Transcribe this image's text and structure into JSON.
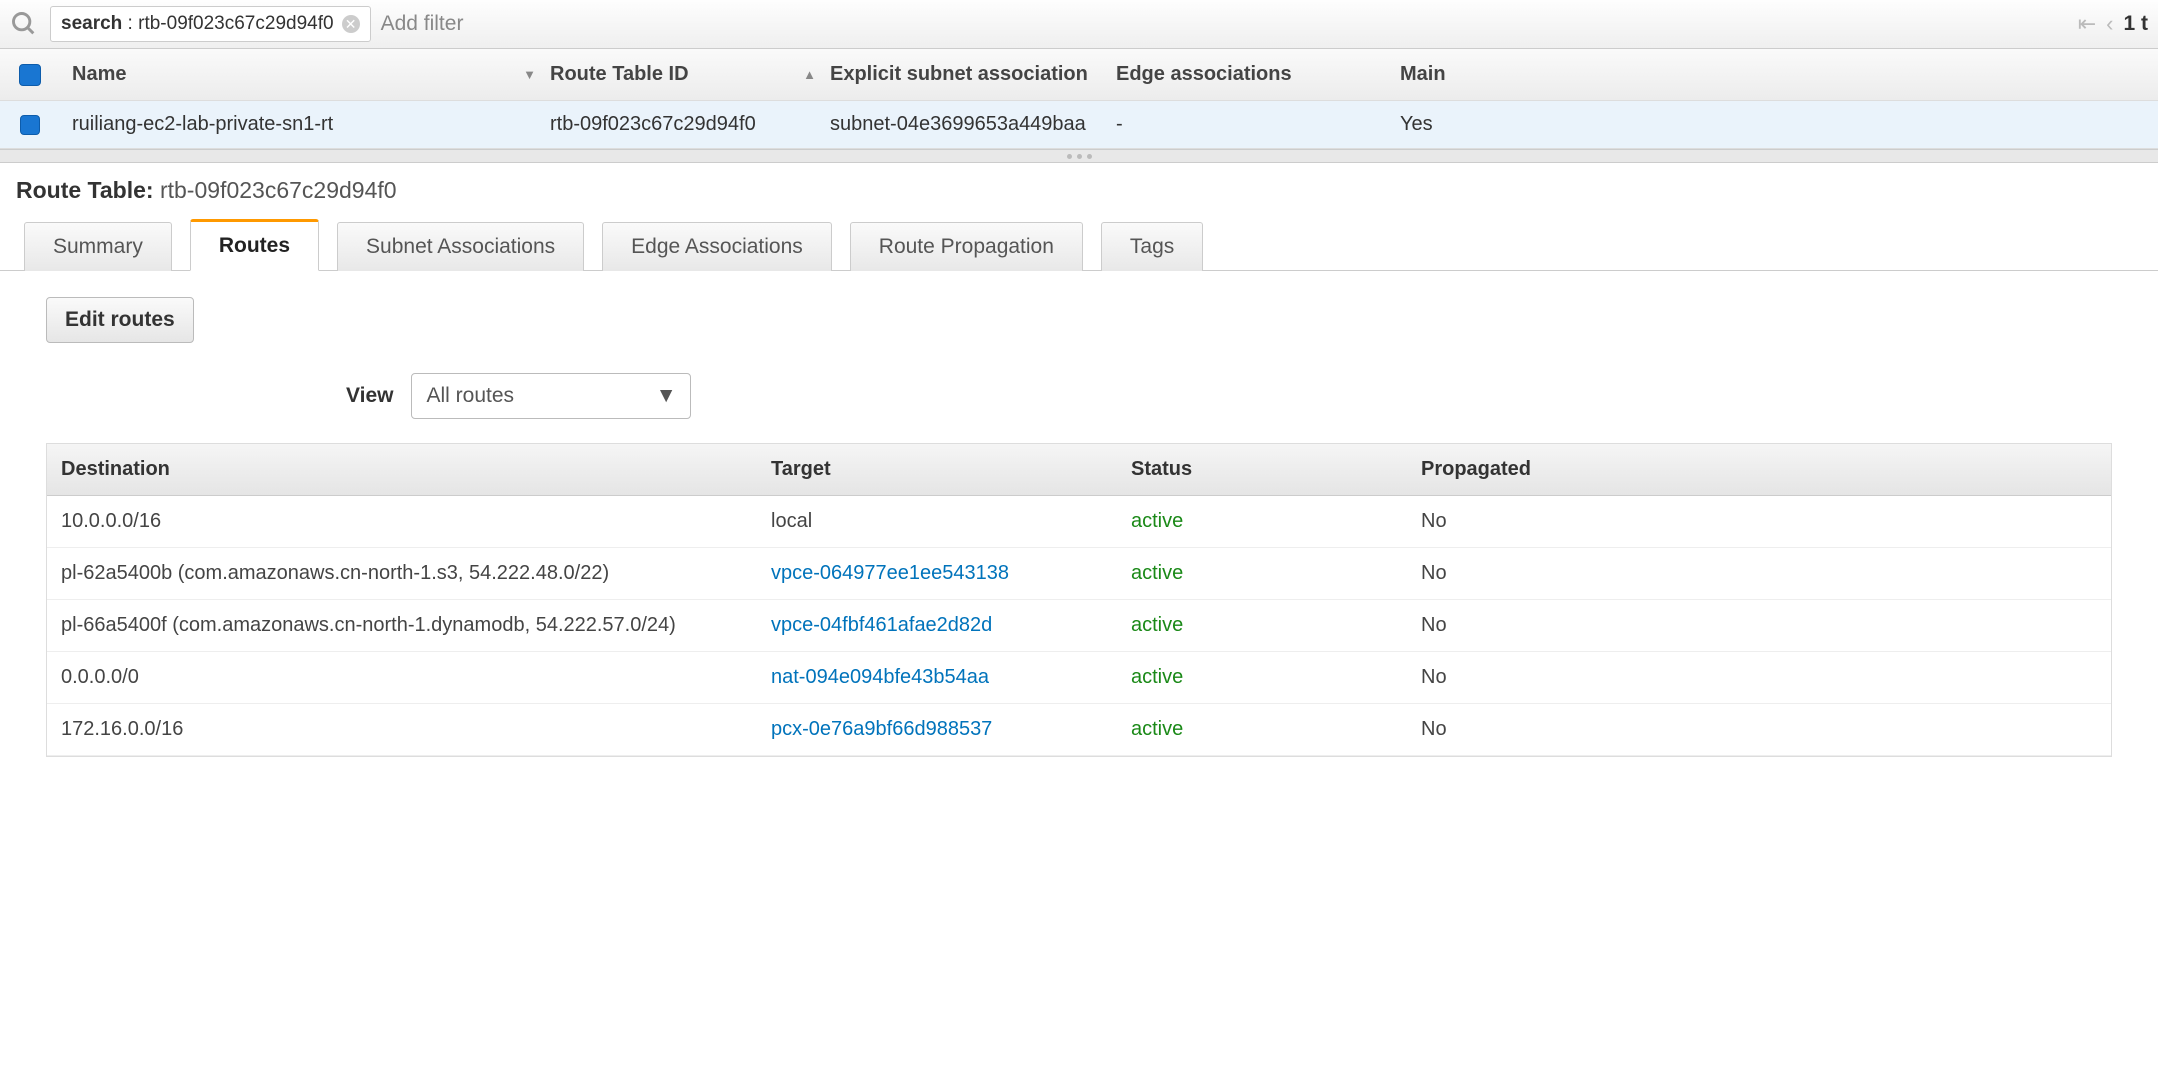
{
  "filter": {
    "key": "search",
    "value": "rtb-09f023c67c29d94f0",
    "placeholder": "Add filter"
  },
  "pager": {
    "count": "1 t"
  },
  "mainTable": {
    "headers": {
      "name": "Name",
      "rtid": "Route Table ID",
      "subnet": "Explicit subnet association",
      "edge": "Edge associations",
      "main": "Main"
    },
    "rows": [
      {
        "name": "ruiliang-ec2-lab-private-sn1-rt",
        "rtid": "rtb-09f023c67c29d94f0",
        "subnet": "subnet-04e3699653a449baa",
        "edge": "-",
        "main": "Yes"
      }
    ]
  },
  "detail": {
    "label": "Route Table:",
    "value": "rtb-09f023c67c29d94f0"
  },
  "tabs": [
    "Summary",
    "Routes",
    "Subnet Associations",
    "Edge Associations",
    "Route Propagation",
    "Tags"
  ],
  "routesPanel": {
    "editButton": "Edit routes",
    "viewLabel": "View",
    "viewSelected": "All routes",
    "headers": {
      "dest": "Destination",
      "target": "Target",
      "status": "Status",
      "prop": "Propagated"
    },
    "rows": [
      {
        "dest": "10.0.0.0/16",
        "target": "local",
        "targetLink": false,
        "status": "active",
        "prop": "No"
      },
      {
        "dest": "pl-62a5400b (com.amazonaws.cn-north-1.s3, 54.222.48.0/22)",
        "target": "vpce-064977ee1ee543138",
        "targetLink": true,
        "status": "active",
        "prop": "No"
      },
      {
        "dest": "pl-66a5400f (com.amazonaws.cn-north-1.dynamodb, 54.222.57.0/24)",
        "target": "vpce-04fbf461afae2d82d",
        "targetLink": true,
        "status": "active",
        "prop": "No"
      },
      {
        "dest": "0.0.0.0/0",
        "target": "nat-094e094bfe43b54aa",
        "targetLink": true,
        "status": "active",
        "prop": "No"
      },
      {
        "dest": "172.16.0.0/16",
        "target": "pcx-0e76a9bf66d988537",
        "targetLink": true,
        "status": "active",
        "prop": "No"
      }
    ]
  }
}
